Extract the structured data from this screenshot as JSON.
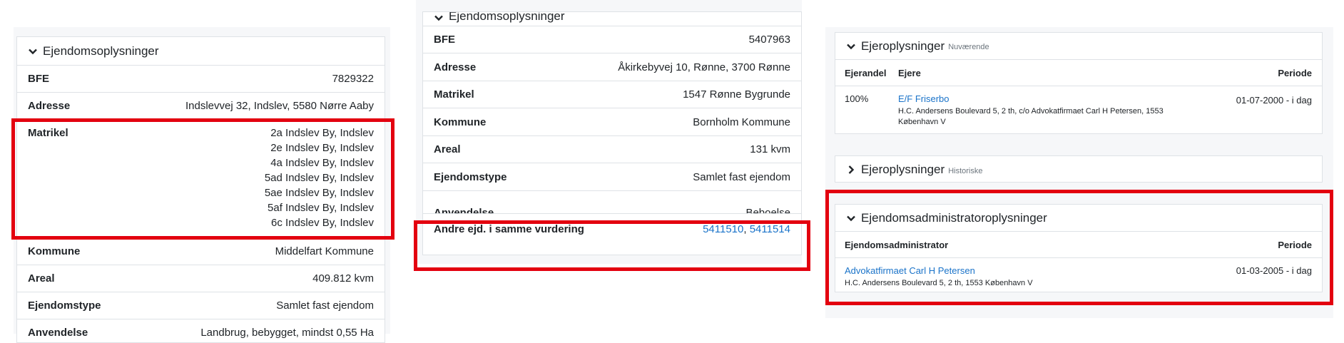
{
  "left": {
    "header": "Ejendomsoplysninger",
    "rows": [
      {
        "key": "BFE",
        "value": "7829322"
      },
      {
        "key": "Adresse",
        "value": "Indslevvej 32, Indslev, 5580 Nørre Aaby"
      }
    ],
    "matrikel_key": "Matrikel",
    "matrikel_values": [
      "2a Indslev By, Indslev",
      "2e Indslev By, Indslev",
      "4a Indslev By, Indslev",
      "5ad Indslev By, Indslev",
      "5ae Indslev By, Indslev",
      "5af Indslev By, Indslev",
      "6c Indslev By, Indslev"
    ],
    "rows_after": [
      {
        "key": "Kommune",
        "value": "Middelfart Kommune"
      },
      {
        "key": "Areal",
        "value": "409.812 kvm"
      },
      {
        "key": "Ejendomstype",
        "value": "Samlet fast ejendom"
      },
      {
        "key": "Anvendelse",
        "value": "Landbrug, bebygget, mindst 0,55 Ha"
      }
    ]
  },
  "middle": {
    "header": "Ejendomsoplysninger",
    "rows": [
      {
        "key": "BFE",
        "value": "5407963"
      },
      {
        "key": "Adresse",
        "value": "Åkirkebyvej 10, Rønne, 3700 Rønne"
      },
      {
        "key": "Matrikel",
        "value": "1547 Rønne Bygrunde"
      },
      {
        "key": "Kommune",
        "value": "Bornholm Kommune"
      },
      {
        "key": "Areal",
        "value": "131 kvm"
      },
      {
        "key": "Ejendomstype",
        "value": "Samlet fast ejendom"
      },
      {
        "key": "Anvendelse",
        "value": "Beboelse"
      }
    ],
    "andre_key": "Andre ejd. i samme vurdering",
    "andre_links": [
      "5411510",
      "5411514"
    ],
    "andre_sep": ", "
  },
  "right": {
    "owners_current": {
      "header": "Ejeroplysninger",
      "subtitle": "Nuværende",
      "col_share": "Ejerandel",
      "col_owners": "Ejere",
      "col_period": "Periode",
      "share": "100%",
      "owner_name": "E/F Friserbo",
      "owner_address": "H.C. Andersens Boulevard 5, 2 th, c/o Advokatfirmaet Carl H Petersen, 1553 København V",
      "period": "01-07-2000 - i dag"
    },
    "owners_historic": {
      "header": "Ejeroplysninger",
      "subtitle": "Historiske"
    },
    "admin": {
      "header": "Ejendomsadministratoroplysninger",
      "col_admin": "Ejendomsadministrator",
      "col_period": "Periode",
      "name": "Advokatfirmaet Carl H Petersen",
      "address": "H.C. Andersens Boulevard 5, 2 th, 1553 København V",
      "period": "01-03-2005 - i dag"
    }
  },
  "colors": {
    "highlight": "#e3000f",
    "link": "#1a73c9"
  }
}
